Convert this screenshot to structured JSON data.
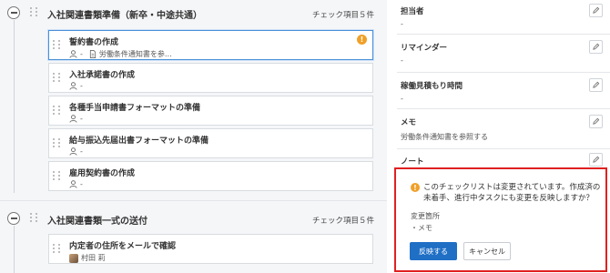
{
  "sections": [
    {
      "title": "入社関連書類準備（新卒・中途共通）",
      "count": "チェック項目５件",
      "tasks": [
        {
          "title": "誓約書の作成",
          "assignee": "-",
          "doc": "労働条件通知書を参…",
          "warning": "!"
        },
        {
          "title": "入社承諾書の作成",
          "assignee": "-"
        },
        {
          "title": "各種手当申請書フォーマットの準備",
          "assignee": "-"
        },
        {
          "title": "給与振込先届出書フォーマットの準備",
          "assignee": "-"
        },
        {
          "title": "雇用契約書の作成",
          "assignee": "-"
        }
      ]
    },
    {
      "title": "入社関連書類一式の送付",
      "count": "チェック項目５件",
      "tasks": [
        {
          "title": "内定者の住所をメールで確認",
          "assignee": "村田 莉"
        }
      ]
    }
  ],
  "detail": {
    "assignee_label": "担当者",
    "assignee_value": "-",
    "reminder_label": "リマインダー",
    "reminder_value": "-",
    "estimate_label": "稼働見積もり時間",
    "estimate_value": "-",
    "memo_label": "メモ",
    "memo_value": "労働条件通知書を参照する",
    "note_label": "ノート",
    "note_value": "-"
  },
  "modal": {
    "icon": "!",
    "message": "このチェックリストは変更されています。作成済の未着手、進行中タスクにも変更を反映しますか？",
    "changes_label": "変更箇所",
    "changes_item": "・メモ",
    "apply_label": "反映する",
    "cancel_label": "キャンセル"
  },
  "colors": {
    "accent": "#1f6fc5",
    "warning": "#f0a028",
    "highlight_border": "#e02020",
    "active_border": "#4a8fd8"
  }
}
